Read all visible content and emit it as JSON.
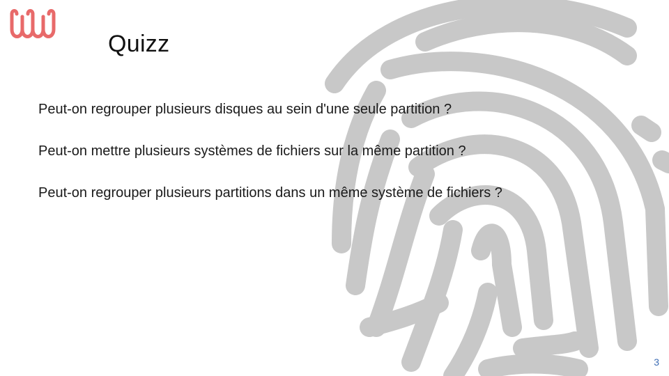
{
  "slide": {
    "title": "Quizz",
    "questions": [
      "Peut-on regrouper plusieurs disques au sein d'une seule partition ?",
      "Peut-on mettre plusieurs systèmes de fichiers sur la même partition ?",
      "Peut-on regrouper plusieurs partitions dans un même système de fichiers ?"
    ],
    "page_number": "3"
  },
  "decor": {
    "logo_icon": "wave-logo-icon",
    "background_icon": "fingerprint-icon",
    "colors": {
      "logo": "#e86a6a",
      "fingerprint": "#c8c8c8",
      "page_number": "#3d6db5",
      "text": "#1a1a1a"
    }
  }
}
